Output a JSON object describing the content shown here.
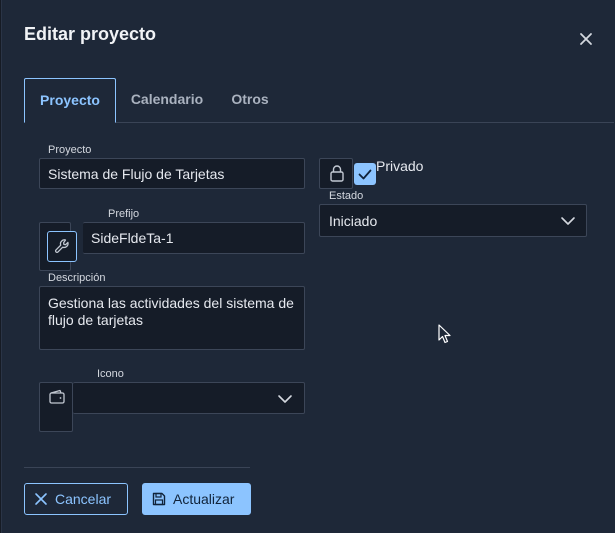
{
  "dialog": {
    "title": "Editar proyecto",
    "close_icon": "close-icon"
  },
  "tabs": [
    {
      "label": "Proyecto",
      "active": true
    },
    {
      "label": "Calendario",
      "active": false
    },
    {
      "label": "Otros",
      "active": false
    }
  ],
  "form": {
    "proyecto": {
      "label": "Proyecto",
      "value": "Sistema de Flujo de Tarjetas"
    },
    "privado": {
      "label": "Privado",
      "checked": true,
      "lock_icon": "lock-icon"
    },
    "prefijo": {
      "label": "Prefijo",
      "value": "SideFldeTa-1",
      "icon": "wrench-icon"
    },
    "estado": {
      "label": "Estado",
      "value": "Iniciado"
    },
    "descripcion": {
      "label": "Descripción",
      "value": "Gestiona las actividades del sistema de flujo de tarjetas"
    },
    "icono": {
      "label": "Icono",
      "value": "",
      "icon": "wallet-icon"
    }
  },
  "footer": {
    "cancel_label": "Cancelar",
    "update_label": "Actualizar"
  },
  "colors": {
    "accent": "#8cc4ff",
    "background": "#1e2838",
    "field": "#151c28"
  }
}
